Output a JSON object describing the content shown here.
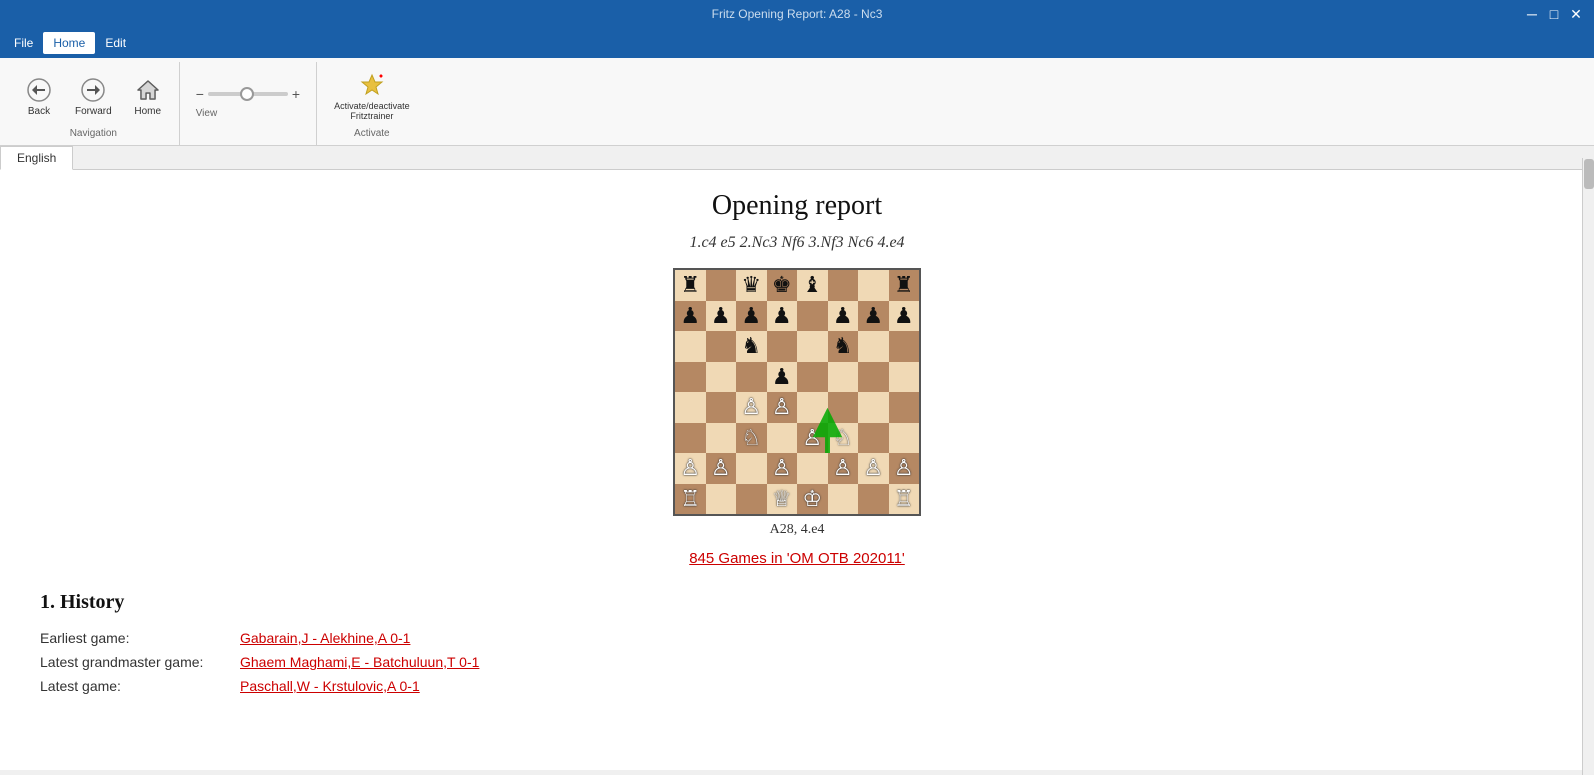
{
  "titlebar": {
    "title": "Fritz Opening Report: A28 - Nc3",
    "minimize": "─",
    "maximize": "□",
    "close": "✕"
  },
  "menubar": {
    "items": [
      {
        "label": "File",
        "active": false
      },
      {
        "label": "Home",
        "active": true
      },
      {
        "label": "Edit",
        "active": false
      }
    ]
  },
  "ribbon": {
    "navigation_group": {
      "label": "Navigation",
      "back_label": "Back",
      "forward_label": "Forward",
      "home_label": "Home"
    },
    "view_group": {
      "label": "View"
    },
    "activate_group": {
      "label": "Activate",
      "button_label": "Activate/deactivate\nFritztrainer"
    }
  },
  "tab": {
    "label": "English"
  },
  "report": {
    "title": "Opening report",
    "moves": "1.c4 e5 2.Nc3 Nf6 3.Nf3 Nc6 4.e4",
    "eco_label": "A28, 4.e4",
    "games_link": "845 Games in 'OM OTB 202011'",
    "section1_title": "1. History",
    "earliest_label": "Earliest game:",
    "earliest_value": "Gabarain,J - Alekhine,A 0-1",
    "latest_gm_label": "Latest grandmaster game:",
    "latest_gm_value": "Ghaem Maghami,E - Batchuluun,T 0-1",
    "latest_label": "Latest game:",
    "latest_value": "Paschall,W - Krstulovic,A 0-1"
  },
  "chessboard": {
    "pieces": [
      {
        "square": "a8",
        "piece": "♜",
        "col": 0,
        "row": 0
      },
      {
        "square": "b8",
        "piece": "",
        "col": 1,
        "row": 0
      },
      {
        "square": "c8",
        "piece": "♛",
        "col": 2,
        "row": 0
      },
      {
        "square": "d8",
        "piece": "♚",
        "col": 3,
        "row": 0
      },
      {
        "square": "e8",
        "piece": "♝",
        "col": 4,
        "row": 0
      },
      {
        "square": "f8",
        "piece": "",
        "col": 5,
        "row": 0
      },
      {
        "square": "g8",
        "piece": "",
        "col": 6,
        "row": 0
      },
      {
        "square": "h8",
        "piece": "♜",
        "col": 7,
        "row": 0
      },
      {
        "square": "a7",
        "piece": "♟",
        "col": 0,
        "row": 1
      },
      {
        "square": "b7",
        "piece": "♟",
        "col": 1,
        "row": 1
      },
      {
        "square": "c7",
        "piece": "♟",
        "col": 2,
        "row": 1
      },
      {
        "square": "d7",
        "piece": "♟",
        "col": 3,
        "row": 1
      },
      {
        "square": "e7",
        "piece": "",
        "col": 4,
        "row": 1
      },
      {
        "square": "f7",
        "piece": "♟",
        "col": 5,
        "row": 1
      },
      {
        "square": "g7",
        "piece": "♟",
        "col": 6,
        "row": 1
      },
      {
        "square": "h7",
        "piece": "♟",
        "col": 7,
        "row": 1
      },
      {
        "square": "a6",
        "piece": "",
        "col": 0,
        "row": 2
      },
      {
        "square": "b6",
        "piece": "",
        "col": 1,
        "row": 2
      },
      {
        "square": "c6",
        "piece": "♞",
        "col": 2,
        "row": 2
      },
      {
        "square": "d6",
        "piece": "",
        "col": 3,
        "row": 2
      },
      {
        "square": "e6",
        "piece": "",
        "col": 4,
        "row": 2
      },
      {
        "square": "f6",
        "piece": "♞",
        "col": 5,
        "row": 2
      },
      {
        "square": "g6",
        "piece": "",
        "col": 6,
        "row": 2
      },
      {
        "square": "h6",
        "piece": "",
        "col": 7,
        "row": 2
      },
      {
        "square": "a5",
        "piece": "",
        "col": 0,
        "row": 3
      },
      {
        "square": "b5",
        "piece": "",
        "col": 1,
        "row": 3
      },
      {
        "square": "c5",
        "piece": "",
        "col": 2,
        "row": 3
      },
      {
        "square": "d5",
        "piece": "♟",
        "col": 3,
        "row": 3
      },
      {
        "square": "e5",
        "piece": "",
        "col": 4,
        "row": 3
      },
      {
        "square": "f5",
        "piece": "",
        "col": 5,
        "row": 3
      },
      {
        "square": "g5",
        "piece": "",
        "col": 6,
        "row": 3
      },
      {
        "square": "h5",
        "piece": "",
        "col": 7,
        "row": 3
      },
      {
        "square": "a4",
        "piece": "",
        "col": 0,
        "row": 4
      },
      {
        "square": "b4",
        "piece": "",
        "col": 1,
        "row": 4
      },
      {
        "square": "c4",
        "piece": "♙",
        "col": 2,
        "row": 4
      },
      {
        "square": "d4",
        "piece": "♙",
        "col": 3,
        "row": 4
      },
      {
        "square": "e4",
        "piece": "",
        "col": 4,
        "row": 4
      },
      {
        "square": "f4",
        "piece": "",
        "col": 5,
        "row": 4
      },
      {
        "square": "g4",
        "piece": "",
        "col": 6,
        "row": 4
      },
      {
        "square": "h4",
        "piece": "",
        "col": 7,
        "row": 4
      },
      {
        "square": "a3",
        "piece": "",
        "col": 0,
        "row": 5
      },
      {
        "square": "b3",
        "piece": "",
        "col": 1,
        "row": 5
      },
      {
        "square": "c3",
        "piece": "♘",
        "col": 2,
        "row": 5
      },
      {
        "square": "d3",
        "piece": "",
        "col": 3,
        "row": 5
      },
      {
        "square": "e3",
        "piece": "♙",
        "col": 4,
        "row": 5
      },
      {
        "square": "f3",
        "piece": "♘",
        "col": 5,
        "row": 5
      },
      {
        "square": "g3",
        "piece": "",
        "col": 6,
        "row": 5
      },
      {
        "square": "h3",
        "piece": "",
        "col": 7,
        "row": 5
      },
      {
        "square": "a2",
        "piece": "♙",
        "col": 0,
        "row": 6
      },
      {
        "square": "b2",
        "piece": "♙",
        "col": 1,
        "row": 6
      },
      {
        "square": "c2",
        "piece": "",
        "col": 2,
        "row": 6
      },
      {
        "square": "d2",
        "piece": "♙",
        "col": 3,
        "row": 6
      },
      {
        "square": "e2",
        "piece": "",
        "col": 4,
        "row": 6
      },
      {
        "square": "f2",
        "piece": "♙",
        "col": 5,
        "row": 6
      },
      {
        "square": "g2",
        "piece": "♙",
        "col": 6,
        "row": 6
      },
      {
        "square": "h2",
        "piece": "♙",
        "col": 7,
        "row": 6
      },
      {
        "square": "a1",
        "piece": "♖",
        "col": 0,
        "row": 7
      },
      {
        "square": "b1",
        "piece": "",
        "col": 1,
        "row": 7
      },
      {
        "square": "c1",
        "piece": "",
        "col": 2,
        "row": 7
      },
      {
        "square": "d1",
        "piece": "♕",
        "col": 3,
        "row": 7
      },
      {
        "square": "e1",
        "piece": "♔",
        "col": 4,
        "row": 7
      },
      {
        "square": "f1",
        "piece": "",
        "col": 5,
        "row": 7
      },
      {
        "square": "g1",
        "piece": "",
        "col": 6,
        "row": 7
      },
      {
        "square": "h1",
        "piece": "♖",
        "col": 7,
        "row": 7
      }
    ]
  }
}
